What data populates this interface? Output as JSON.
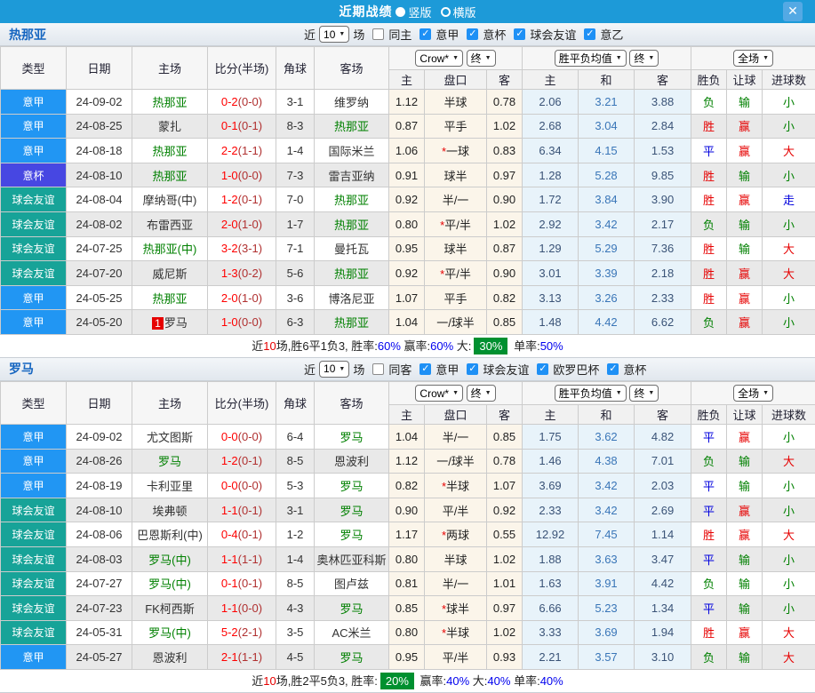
{
  "titlebar": {
    "title": "近期战绩",
    "radio_vertical": "竖版",
    "radio_horizontal": "横版",
    "close": "✕"
  },
  "colors": {
    "titlebar_blue": "#1d9ad8",
    "badge_league": "#2196f3",
    "badge_cup": "#4747e2",
    "badge_friendly": "#17a398",
    "team_green": "#008000",
    "win_red": "#e60000",
    "draw_blue": "#0000dd",
    "highlight_green_box": "#009030"
  },
  "table_header": {
    "cols": [
      "类型",
      "日期",
      "主场",
      "比分(半场)",
      "角球",
      "客场"
    ],
    "subcols": [
      "主",
      "盘口",
      "客",
      "主",
      "和",
      "客",
      "胜负",
      "让球",
      "进球数"
    ],
    "dropdown_company": "Crow*",
    "dropdown_final": "终",
    "dropdown_avg": "胜平负均值",
    "dropdown_fulltime": "全场"
  },
  "sections": [
    {
      "team": "热那亚",
      "filters": {
        "prefix": "近",
        "count": "10",
        "suffix": "场",
        "unchecked_label": "同主",
        "checked_labels": [
          "意甲",
          "意杯",
          "球会友谊",
          "意乙"
        ]
      },
      "rows": [
        {
          "type": "意甲",
          "typeKey": "league",
          "date": "24-09-02",
          "home": "热那亚",
          "homeGreen": true,
          "homeBadge": "",
          "score": "0-2",
          "half": "(0-0)",
          "corner": "3-1",
          "away": "维罗纳",
          "awayGreen": false,
          "o1": "1.12",
          "panStar": false,
          "pan": "半球",
          "o2": "0.78",
          "a1": "2.06",
          "a2": "3.21",
          "a3": "3.88",
          "r1": "负",
          "c1": "g",
          "r2": "输",
          "c2": "g",
          "r3": "小",
          "c3": "g"
        },
        {
          "type": "意甲",
          "typeKey": "league",
          "date": "24-08-25",
          "home": "蒙扎",
          "homeGreen": false,
          "homeBadge": "",
          "score": "0-1",
          "half": "(0-1)",
          "corner": "8-3",
          "away": "热那亚",
          "awayGreen": true,
          "o1": "0.87",
          "panStar": false,
          "pan": "平手",
          "o2": "1.02",
          "a1": "2.68",
          "a2": "3.04",
          "a3": "2.84",
          "r1": "胜",
          "c1": "r",
          "r2": "赢",
          "c2": "r",
          "r3": "小",
          "c3": "g"
        },
        {
          "type": "意甲",
          "typeKey": "league",
          "date": "24-08-18",
          "home": "热那亚",
          "homeGreen": true,
          "homeBadge": "",
          "score": "2-2",
          "half": "(1-1)",
          "corner": "1-4",
          "away": "国际米兰",
          "awayGreen": false,
          "o1": "1.06",
          "panStar": true,
          "pan": "一球",
          "o2": "0.83",
          "a1": "6.34",
          "a2": "4.15",
          "a3": "1.53",
          "r1": "平",
          "c1": "b",
          "r2": "赢",
          "c2": "r",
          "r3": "大",
          "c3": "r"
        },
        {
          "type": "意杯",
          "typeKey": "cup",
          "date": "24-08-10",
          "home": "热那亚",
          "homeGreen": true,
          "homeBadge": "",
          "score": "1-0",
          "half": "(0-0)",
          "corner": "7-3",
          "away": "雷吉亚纳",
          "awayGreen": false,
          "o1": "0.91",
          "panStar": false,
          "pan": "球半",
          "o2": "0.97",
          "a1": "1.28",
          "a2": "5.28",
          "a3": "9.85",
          "r1": "胜",
          "c1": "r",
          "r2": "输",
          "c2": "g",
          "r3": "小",
          "c3": "g"
        },
        {
          "type": "球会友谊",
          "typeKey": "friendly",
          "date": "24-08-04",
          "home": "摩纳哥(中)",
          "homeGreen": false,
          "homeBadge": "",
          "score": "1-2",
          "half": "(0-1)",
          "corner": "7-0",
          "away": "热那亚",
          "awayGreen": true,
          "o1": "0.92",
          "panStar": false,
          "pan": "半/一",
          "o2": "0.90",
          "a1": "1.72",
          "a2": "3.84",
          "a3": "3.90",
          "r1": "胜",
          "c1": "r",
          "r2": "赢",
          "c2": "r",
          "r3": "走",
          "c3": "b"
        },
        {
          "type": "球会友谊",
          "typeKey": "friendly",
          "date": "24-08-02",
          "home": "布雷西亚",
          "homeGreen": false,
          "homeBadge": "",
          "score": "2-0",
          "half": "(1-0)",
          "corner": "1-7",
          "away": "热那亚",
          "awayGreen": true,
          "o1": "0.80",
          "panStar": true,
          "pan": "平/半",
          "o2": "1.02",
          "a1": "2.92",
          "a2": "3.42",
          "a3": "2.17",
          "r1": "负",
          "c1": "g",
          "r2": "输",
          "c2": "g",
          "r3": "小",
          "c3": "g"
        },
        {
          "type": "球会友谊",
          "typeKey": "friendly",
          "date": "24-07-25",
          "home": "热那亚(中)",
          "homeGreen": true,
          "homeBadge": "",
          "score": "3-2",
          "half": "(3-1)",
          "corner": "7-1",
          "away": "曼托瓦",
          "awayGreen": false,
          "o1": "0.95",
          "panStar": false,
          "pan": "球半",
          "o2": "0.87",
          "a1": "1.29",
          "a2": "5.29",
          "a3": "7.36",
          "r1": "胜",
          "c1": "r",
          "r2": "输",
          "c2": "g",
          "r3": "大",
          "c3": "r"
        },
        {
          "type": "球会友谊",
          "typeKey": "friendly",
          "date": "24-07-20",
          "home": "威尼斯",
          "homeGreen": false,
          "homeBadge": "",
          "score": "1-3",
          "half": "(0-2)",
          "corner": "5-6",
          "away": "热那亚",
          "awayGreen": true,
          "o1": "0.92",
          "panStar": true,
          "pan": "平/半",
          "o2": "0.90",
          "a1": "3.01",
          "a2": "3.39",
          "a3": "2.18",
          "r1": "胜",
          "c1": "r",
          "r2": "赢",
          "c2": "r",
          "r3": "大",
          "c3": "r"
        },
        {
          "type": "意甲",
          "typeKey": "league",
          "date": "24-05-25",
          "home": "热那亚",
          "homeGreen": true,
          "homeBadge": "",
          "score": "2-0",
          "half": "(1-0)",
          "corner": "3-6",
          "away": "博洛尼亚",
          "awayGreen": false,
          "o1": "1.07",
          "panStar": false,
          "pan": "平手",
          "o2": "0.82",
          "a1": "3.13",
          "a2": "3.26",
          "a3": "2.33",
          "r1": "胜",
          "c1": "r",
          "r2": "赢",
          "c2": "r",
          "r3": "小",
          "c3": "g"
        },
        {
          "type": "意甲",
          "typeKey": "league",
          "date": "24-05-20",
          "home": "罗马",
          "homeGreen": false,
          "homeBadge": "1",
          "score": "1-0",
          "half": "(0-0)",
          "corner": "6-3",
          "away": "热那亚",
          "awayGreen": true,
          "o1": "1.04",
          "panStar": false,
          "pan": "一/球半",
          "o2": "0.85",
          "a1": "1.48",
          "a2": "4.42",
          "a3": "6.62",
          "r1": "负",
          "c1": "g",
          "r2": "赢",
          "c2": "r",
          "r3": "小",
          "c3": "g"
        }
      ],
      "summary": [
        {
          "t": "近",
          "c": ""
        },
        {
          "t": "10",
          "c": "red"
        },
        {
          "t": "场,胜6平1负3, 胜率:",
          "c": ""
        },
        {
          "t": "60%",
          "c": "blue"
        },
        {
          "t": " 赢率:",
          "c": ""
        },
        {
          "t": "60%",
          "c": "blue"
        },
        {
          "t": " 大:",
          "c": ""
        },
        {
          "t": "30%",
          "c": "greenbox"
        },
        {
          "t": " 单率:",
          "c": ""
        },
        {
          "t": "50%",
          "c": "blue"
        }
      ]
    },
    {
      "team": "罗马",
      "filters": {
        "prefix": "近",
        "count": "10",
        "suffix": "场",
        "unchecked_label": "同客",
        "checked_labels": [
          "意甲",
          "球会友谊",
          "欧罗巴杯",
          "意杯"
        ]
      },
      "rows": [
        {
          "type": "意甲",
          "typeKey": "league",
          "date": "24-09-02",
          "home": "尤文图斯",
          "homeGreen": false,
          "homeBadge": "",
          "score": "0-0",
          "half": "(0-0)",
          "corner": "6-4",
          "away": "罗马",
          "awayGreen": true,
          "o1": "1.04",
          "panStar": false,
          "pan": "半/一",
          "o2": "0.85",
          "a1": "1.75",
          "a2": "3.62",
          "a3": "4.82",
          "r1": "平",
          "c1": "b",
          "r2": "赢",
          "c2": "r",
          "r3": "小",
          "c3": "g"
        },
        {
          "type": "意甲",
          "typeKey": "league",
          "date": "24-08-26",
          "home": "罗马",
          "homeGreen": true,
          "homeBadge": "",
          "score": "1-2",
          "half": "(0-1)",
          "corner": "8-5",
          "away": "恩波利",
          "awayGreen": false,
          "o1": "1.12",
          "panStar": false,
          "pan": "一/球半",
          "o2": "0.78",
          "a1": "1.46",
          "a2": "4.38",
          "a3": "7.01",
          "r1": "负",
          "c1": "g",
          "r2": "输",
          "c2": "g",
          "r3": "大",
          "c3": "r"
        },
        {
          "type": "意甲",
          "typeKey": "league",
          "date": "24-08-19",
          "home": "卡利亚里",
          "homeGreen": false,
          "homeBadge": "",
          "score": "0-0",
          "half": "(0-0)",
          "corner": "5-3",
          "away": "罗马",
          "awayGreen": true,
          "o1": "0.82",
          "panStar": true,
          "pan": "半球",
          "o2": "1.07",
          "a1": "3.69",
          "a2": "3.42",
          "a3": "2.03",
          "r1": "平",
          "c1": "b",
          "r2": "输",
          "c2": "g",
          "r3": "小",
          "c3": "g"
        },
        {
          "type": "球会友谊",
          "typeKey": "friendly",
          "date": "24-08-10",
          "home": "埃弗顿",
          "homeGreen": false,
          "homeBadge": "",
          "score": "1-1",
          "half": "(0-1)",
          "corner": "3-1",
          "away": "罗马",
          "awayGreen": true,
          "o1": "0.90",
          "panStar": false,
          "pan": "平/半",
          "o2": "0.92",
          "a1": "2.33",
          "a2": "3.42",
          "a3": "2.69",
          "r1": "平",
          "c1": "b",
          "r2": "赢",
          "c2": "r",
          "r3": "小",
          "c3": "g"
        },
        {
          "type": "球会友谊",
          "typeKey": "friendly",
          "date": "24-08-06",
          "home": "巴恩斯利(中)",
          "homeGreen": false,
          "homeBadge": "",
          "score": "0-4",
          "half": "(0-1)",
          "corner": "1-2",
          "away": "罗马",
          "awayGreen": true,
          "o1": "1.17",
          "panStar": true,
          "pan": "两球",
          "o2": "0.55",
          "a1": "12.92",
          "a2": "7.45",
          "a3": "1.14",
          "r1": "胜",
          "c1": "r",
          "r2": "赢",
          "c2": "r",
          "r3": "大",
          "c3": "r"
        },
        {
          "type": "球会友谊",
          "typeKey": "friendly",
          "date": "24-08-03",
          "home": "罗马(中)",
          "homeGreen": true,
          "homeBadge": "",
          "score": "1-1",
          "half": "(1-1)",
          "corner": "1-4",
          "away": "奥林匹亚科斯",
          "awayGreen": false,
          "o1": "0.80",
          "panStar": false,
          "pan": "半球",
          "o2": "1.02",
          "a1": "1.88",
          "a2": "3.63",
          "a3": "3.47",
          "r1": "平",
          "c1": "b",
          "r2": "输",
          "c2": "g",
          "r3": "小",
          "c3": "g"
        },
        {
          "type": "球会友谊",
          "typeKey": "friendly",
          "date": "24-07-27",
          "home": "罗马(中)",
          "homeGreen": true,
          "homeBadge": "",
          "score": "0-1",
          "half": "(0-1)",
          "corner": "8-5",
          "away": "图卢兹",
          "awayGreen": false,
          "o1": "0.81",
          "panStar": false,
          "pan": "半/一",
          "o2": "1.01",
          "a1": "1.63",
          "a2": "3.91",
          "a3": "4.42",
          "r1": "负",
          "c1": "g",
          "r2": "输",
          "c2": "g",
          "r3": "小",
          "c3": "g"
        },
        {
          "type": "球会友谊",
          "typeKey": "friendly",
          "date": "24-07-23",
          "home": "FK柯西斯",
          "homeGreen": false,
          "homeBadge": "",
          "score": "1-1",
          "half": "(0-0)",
          "corner": "4-3",
          "away": "罗马",
          "awayGreen": true,
          "o1": "0.85",
          "panStar": true,
          "pan": "球半",
          "o2": "0.97",
          "a1": "6.66",
          "a2": "5.23",
          "a3": "1.34",
          "r1": "平",
          "c1": "b",
          "r2": "输",
          "c2": "g",
          "r3": "小",
          "c3": "g"
        },
        {
          "type": "球会友谊",
          "typeKey": "friendly",
          "date": "24-05-31",
          "home": "罗马(中)",
          "homeGreen": true,
          "homeBadge": "",
          "score": "5-2",
          "half": "(2-1)",
          "corner": "3-5",
          "away": "AC米兰",
          "awayGreen": false,
          "o1": "0.80",
          "panStar": true,
          "pan": "半球",
          "o2": "1.02",
          "a1": "3.33",
          "a2": "3.69",
          "a3": "1.94",
          "r1": "胜",
          "c1": "r",
          "r2": "赢",
          "c2": "r",
          "r3": "大",
          "c3": "r"
        },
        {
          "type": "意甲",
          "typeKey": "league",
          "date": "24-05-27",
          "home": "恩波利",
          "homeGreen": false,
          "homeBadge": "",
          "score": "2-1",
          "half": "(1-1)",
          "corner": "4-5",
          "away": "罗马",
          "awayGreen": true,
          "o1": "0.95",
          "panStar": false,
          "pan": "平/半",
          "o2": "0.93",
          "a1": "2.21",
          "a2": "3.57",
          "a3": "3.10",
          "r1": "负",
          "c1": "g",
          "r2": "输",
          "c2": "g",
          "r3": "大",
          "c3": "r"
        }
      ],
      "summary": [
        {
          "t": "近",
          "c": ""
        },
        {
          "t": "10",
          "c": "red"
        },
        {
          "t": "场,胜2平5负3, 胜率:",
          "c": ""
        },
        {
          "t": "20%",
          "c": "greenbox"
        },
        {
          "t": " 赢率:",
          "c": ""
        },
        {
          "t": "40%",
          "c": "blue"
        },
        {
          "t": " 大:",
          "c": ""
        },
        {
          "t": "40%",
          "c": "blue"
        },
        {
          "t": " 单率:",
          "c": ""
        },
        {
          "t": "40%",
          "c": "blue"
        }
      ]
    }
  ]
}
